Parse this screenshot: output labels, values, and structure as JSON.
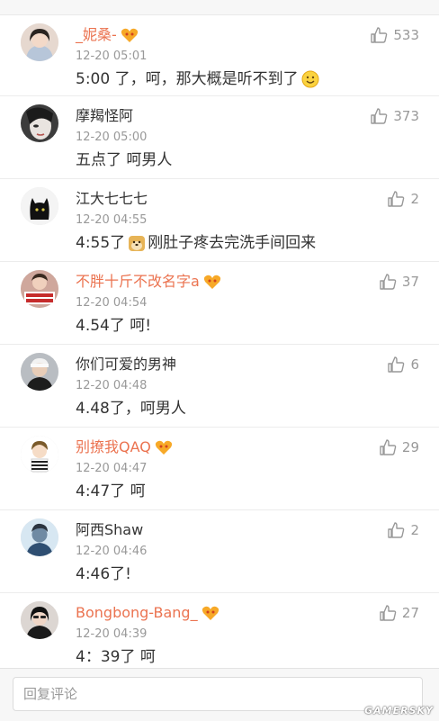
{
  "comments": [
    {
      "name": "_妮桑-",
      "name_color": "orange",
      "vip": true,
      "time": "12-20 05:01",
      "text": "5:00 了，呵，那大概是听不到了",
      "emoji": "smile-emoji",
      "likes": "533"
    },
    {
      "name": "摩羯怪阿",
      "name_color": "normal",
      "vip": false,
      "time": "12-20 05:00",
      "text": "五点了 呵男人",
      "emoji": "",
      "likes": "373"
    },
    {
      "name": "江大七七七",
      "name_color": "normal",
      "vip": false,
      "time": "12-20 04:55",
      "text_pre": "4:55了",
      "text": "刚肚子疼去完洗手间回来",
      "emoji": "doge-emoji",
      "likes": "2"
    },
    {
      "name": "不胖十斤不改名字a",
      "name_color": "orange",
      "vip": true,
      "time": "12-20 04:54",
      "text": "4.54了 呵!",
      "emoji": "",
      "likes": "37"
    },
    {
      "name": "你们可爱的男神",
      "name_color": "normal",
      "vip": false,
      "time": "12-20 04:48",
      "text": "4.48了，呵男人",
      "emoji": "",
      "likes": "6"
    },
    {
      "name": "别撩我QAQ",
      "name_color": "orange",
      "vip": true,
      "time": "12-20 04:47",
      "text": "4:47了 呵",
      "emoji": "",
      "likes": "29"
    },
    {
      "name": "阿西Shaw",
      "name_color": "normal",
      "vip": false,
      "time": "12-20 04:46",
      "text": "4:46了!",
      "emoji": "",
      "likes": "2"
    },
    {
      "name": "Bongbong-Bang_",
      "name_color": "orange",
      "vip": true,
      "time": "12-20 04:39",
      "text": "4：39了 呵",
      "emoji": "",
      "likes": "27"
    }
  ],
  "reply": {
    "placeholder": "回复评论"
  },
  "watermark": "GAMERSKY",
  "colors": {
    "vip_name": "#eb7350",
    "meta": "#999999",
    "text": "#333333"
  }
}
